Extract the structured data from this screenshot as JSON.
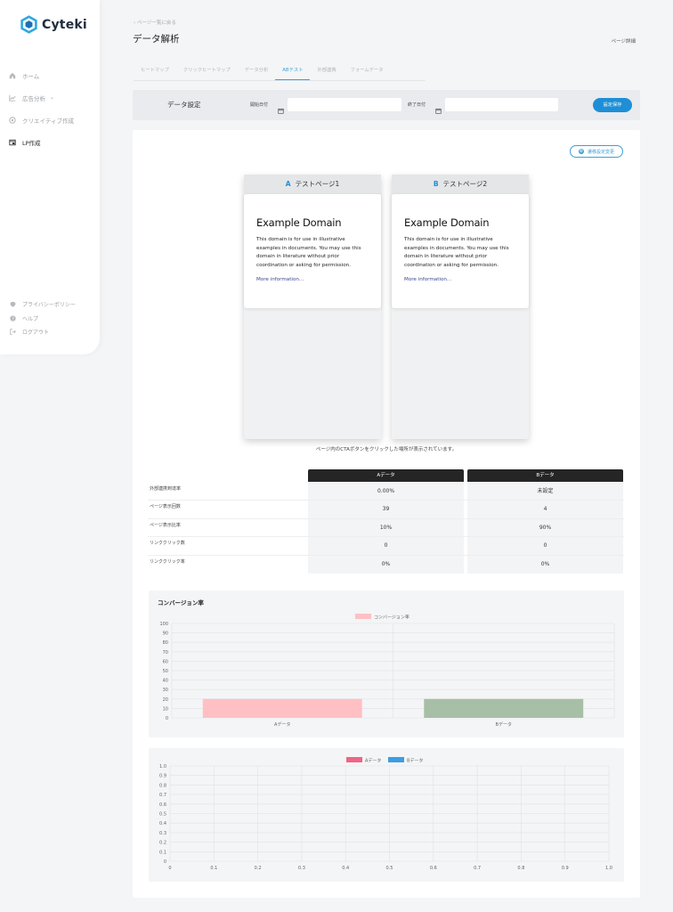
{
  "app": {
    "name": "Cyteki"
  },
  "sidebar": {
    "items": [
      {
        "label": "ホーム",
        "icon": "home-icon"
      },
      {
        "label": "広告分析",
        "icon": "chart-line-icon",
        "has_submenu": true
      },
      {
        "label": "クリエイティブ作成",
        "icon": "palette-icon"
      },
      {
        "label": "LP作成",
        "icon": "lp-icon",
        "active": true
      }
    ],
    "bottom": [
      {
        "label": "プライバシーポリシー",
        "icon": "shield-icon"
      },
      {
        "label": "ヘルプ",
        "icon": "help-icon"
      },
      {
        "label": "ログアウト",
        "icon": "logout-icon"
      }
    ]
  },
  "header": {
    "breadcrumb": "ページ一覧に戻る",
    "title": "データ解析",
    "detail_link": "ページ詳細"
  },
  "tabs": [
    "ヒートマップ",
    "クリックヒートマップ",
    "データ分析",
    "ABテスト",
    "外部連携",
    "フォームデータ"
  ],
  "active_tab": "ABテスト",
  "settings": {
    "title": "データ設定",
    "start_label": "開始日付",
    "end_label": "終了日付",
    "start_value": "",
    "end_value": "",
    "save_label": "設定保存"
  },
  "conditions_button": "遷移設定変更",
  "ab_cards": [
    {
      "letter": "A",
      "page_name": "テストページ1",
      "heading": "Example Domain",
      "body": "This domain is for use in illustrative examples in documents. You may use this domain in literature without prior coordination or asking for permission.",
      "link": "More information..."
    },
    {
      "letter": "B",
      "page_name": "テストページ2",
      "heading": "Example Domain",
      "body": "This domain is for use in illustrative examples in documents. You may use this domain in literature without prior coordination or asking for permission.",
      "link": "More information..."
    }
  ],
  "cta_note": "ページ内のCTAボタンをクリックした場所が表示されています。",
  "comparison": {
    "columns": [
      "Aデータ",
      "Bデータ"
    ],
    "rows": [
      {
        "label": "外部連携到達率",
        "a": "0.00%",
        "b": "未設定"
      },
      {
        "label": "ページ表示回数",
        "a": "39",
        "b": "4"
      },
      {
        "label": "ページ表示比率",
        "a": "10%",
        "b": "90%"
      },
      {
        "label": "リンククリック数",
        "a": "0",
        "b": "0"
      },
      {
        "label": "リンククリック率",
        "a": "0%",
        "b": "0%"
      }
    ]
  },
  "chart_data": [
    {
      "type": "bar",
      "title": "コンバージョン率",
      "categories": [
        "Aデータ",
        "Bデータ"
      ],
      "series": [
        {
          "name": "コンバージョン率",
          "values": [
            20,
            20
          ]
        }
      ],
      "bar_colors": [
        "#ffc0c4",
        "#a7bfa6"
      ],
      "legend_color": "#ffc0c4",
      "ylim": [
        0,
        100
      ],
      "yticks": [
        0,
        10,
        20,
        30,
        40,
        50,
        60,
        70,
        80,
        90,
        100
      ],
      "legend": "top-center",
      "grid": true
    },
    {
      "type": "line",
      "title": "",
      "series": [
        {
          "name": "Aデータ",
          "values": [],
          "color": "#f06385"
        },
        {
          "name": "Bデータ",
          "values": [],
          "color": "#3a9ee0"
        }
      ],
      "xlim": [
        0,
        1
      ],
      "ylim": [
        0,
        1
      ],
      "xticks": [
        0,
        0.1,
        0.2,
        0.3,
        0.4,
        0.5,
        0.6,
        0.7,
        0.8,
        0.9,
        1.0
      ],
      "yticks": [
        0,
        0.1,
        0.2,
        0.3,
        0.4,
        0.5,
        0.6,
        0.7,
        0.8,
        0.9,
        1.0
      ],
      "legend": "top-center",
      "grid": true
    }
  ]
}
